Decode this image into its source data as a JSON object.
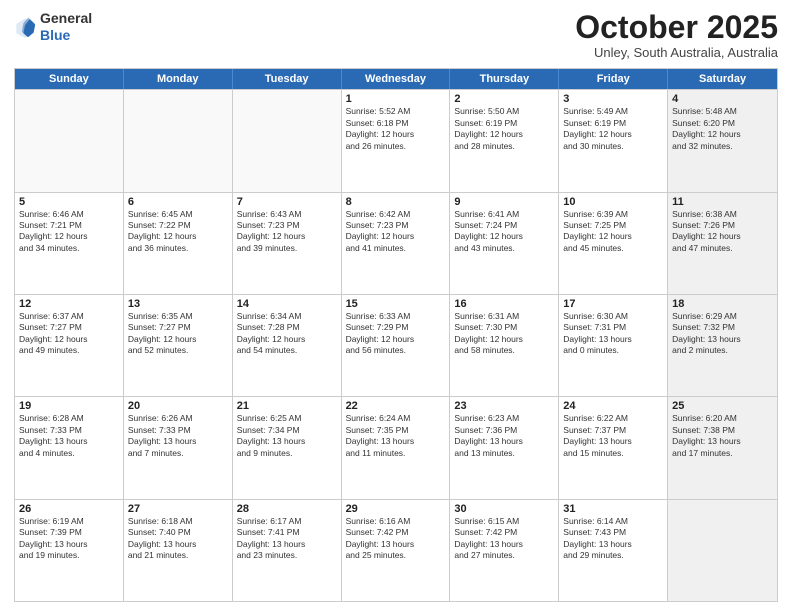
{
  "header": {
    "logo_general": "General",
    "logo_blue": "Blue",
    "month": "October 2025",
    "location": "Unley, South Australia, Australia"
  },
  "days_of_week": [
    "Sunday",
    "Monday",
    "Tuesday",
    "Wednesday",
    "Thursday",
    "Friday",
    "Saturday"
  ],
  "rows": [
    [
      {
        "day": "",
        "text": "",
        "empty": true
      },
      {
        "day": "",
        "text": "",
        "empty": true
      },
      {
        "day": "",
        "text": "",
        "empty": true
      },
      {
        "day": "1",
        "text": "Sunrise: 5:52 AM\nSunset: 6:18 PM\nDaylight: 12 hours\nand 26 minutes."
      },
      {
        "day": "2",
        "text": "Sunrise: 5:50 AM\nSunset: 6:19 PM\nDaylight: 12 hours\nand 28 minutes."
      },
      {
        "day": "3",
        "text": "Sunrise: 5:49 AM\nSunset: 6:19 PM\nDaylight: 12 hours\nand 30 minutes."
      },
      {
        "day": "4",
        "text": "Sunrise: 5:48 AM\nSunset: 6:20 PM\nDaylight: 12 hours\nand 32 minutes.",
        "shaded": true
      }
    ],
    [
      {
        "day": "5",
        "text": "Sunrise: 6:46 AM\nSunset: 7:21 PM\nDaylight: 12 hours\nand 34 minutes."
      },
      {
        "day": "6",
        "text": "Sunrise: 6:45 AM\nSunset: 7:22 PM\nDaylight: 12 hours\nand 36 minutes."
      },
      {
        "day": "7",
        "text": "Sunrise: 6:43 AM\nSunset: 7:23 PM\nDaylight: 12 hours\nand 39 minutes."
      },
      {
        "day": "8",
        "text": "Sunrise: 6:42 AM\nSunset: 7:23 PM\nDaylight: 12 hours\nand 41 minutes."
      },
      {
        "day": "9",
        "text": "Sunrise: 6:41 AM\nSunset: 7:24 PM\nDaylight: 12 hours\nand 43 minutes."
      },
      {
        "day": "10",
        "text": "Sunrise: 6:39 AM\nSunset: 7:25 PM\nDaylight: 12 hours\nand 45 minutes."
      },
      {
        "day": "11",
        "text": "Sunrise: 6:38 AM\nSunset: 7:26 PM\nDaylight: 12 hours\nand 47 minutes.",
        "shaded": true
      }
    ],
    [
      {
        "day": "12",
        "text": "Sunrise: 6:37 AM\nSunset: 7:27 PM\nDaylight: 12 hours\nand 49 minutes."
      },
      {
        "day": "13",
        "text": "Sunrise: 6:35 AM\nSunset: 7:27 PM\nDaylight: 12 hours\nand 52 minutes."
      },
      {
        "day": "14",
        "text": "Sunrise: 6:34 AM\nSunset: 7:28 PM\nDaylight: 12 hours\nand 54 minutes."
      },
      {
        "day": "15",
        "text": "Sunrise: 6:33 AM\nSunset: 7:29 PM\nDaylight: 12 hours\nand 56 minutes."
      },
      {
        "day": "16",
        "text": "Sunrise: 6:31 AM\nSunset: 7:30 PM\nDaylight: 12 hours\nand 58 minutes."
      },
      {
        "day": "17",
        "text": "Sunrise: 6:30 AM\nSunset: 7:31 PM\nDaylight: 13 hours\nand 0 minutes."
      },
      {
        "day": "18",
        "text": "Sunrise: 6:29 AM\nSunset: 7:32 PM\nDaylight: 13 hours\nand 2 minutes.",
        "shaded": true
      }
    ],
    [
      {
        "day": "19",
        "text": "Sunrise: 6:28 AM\nSunset: 7:33 PM\nDaylight: 13 hours\nand 4 minutes."
      },
      {
        "day": "20",
        "text": "Sunrise: 6:26 AM\nSunset: 7:33 PM\nDaylight: 13 hours\nand 7 minutes."
      },
      {
        "day": "21",
        "text": "Sunrise: 6:25 AM\nSunset: 7:34 PM\nDaylight: 13 hours\nand 9 minutes."
      },
      {
        "day": "22",
        "text": "Sunrise: 6:24 AM\nSunset: 7:35 PM\nDaylight: 13 hours\nand 11 minutes."
      },
      {
        "day": "23",
        "text": "Sunrise: 6:23 AM\nSunset: 7:36 PM\nDaylight: 13 hours\nand 13 minutes."
      },
      {
        "day": "24",
        "text": "Sunrise: 6:22 AM\nSunset: 7:37 PM\nDaylight: 13 hours\nand 15 minutes."
      },
      {
        "day": "25",
        "text": "Sunrise: 6:20 AM\nSunset: 7:38 PM\nDaylight: 13 hours\nand 17 minutes.",
        "shaded": true
      }
    ],
    [
      {
        "day": "26",
        "text": "Sunrise: 6:19 AM\nSunset: 7:39 PM\nDaylight: 13 hours\nand 19 minutes."
      },
      {
        "day": "27",
        "text": "Sunrise: 6:18 AM\nSunset: 7:40 PM\nDaylight: 13 hours\nand 21 minutes."
      },
      {
        "day": "28",
        "text": "Sunrise: 6:17 AM\nSunset: 7:41 PM\nDaylight: 13 hours\nand 23 minutes."
      },
      {
        "day": "29",
        "text": "Sunrise: 6:16 AM\nSunset: 7:42 PM\nDaylight: 13 hours\nand 25 minutes."
      },
      {
        "day": "30",
        "text": "Sunrise: 6:15 AM\nSunset: 7:42 PM\nDaylight: 13 hours\nand 27 minutes."
      },
      {
        "day": "31",
        "text": "Sunrise: 6:14 AM\nSunset: 7:43 PM\nDaylight: 13 hours\nand 29 minutes."
      },
      {
        "day": "",
        "text": "",
        "empty": true,
        "shaded": true
      }
    ]
  ]
}
